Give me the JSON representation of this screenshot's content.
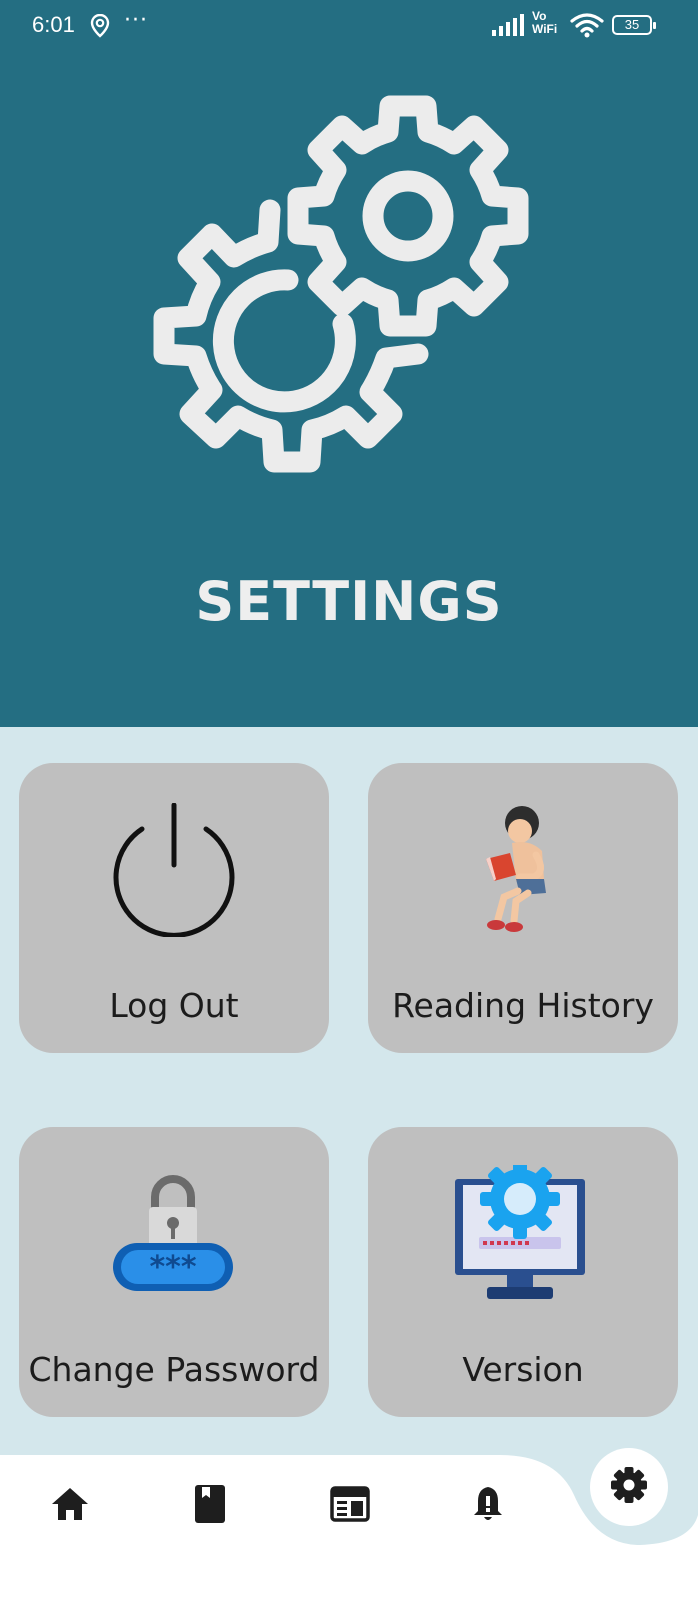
{
  "status_bar": {
    "time": "6:01",
    "dots": "···",
    "network": "Vo\nWiFi",
    "network_line1": "Vo",
    "network_line2": "WiFi",
    "battery": "35"
  },
  "header": {
    "title": "SETTINGS",
    "icon": "gears-icon"
  },
  "cards": [
    {
      "label": "Log Out",
      "icon": "power-icon"
    },
    {
      "label": "Reading History",
      "icon": "reading-person-icon"
    },
    {
      "label": "Change Password",
      "icon": "password-lock-icon"
    },
    {
      "label": "Version",
      "icon": "monitor-settings-icon"
    }
  ],
  "bottom_nav": {
    "items": [
      {
        "icon": "home-icon"
      },
      {
        "icon": "book-icon"
      },
      {
        "icon": "newspaper-icon"
      },
      {
        "icon": "bell-icon"
      },
      {
        "icon": "gear-icon",
        "active": true
      }
    ]
  },
  "colors": {
    "header_bg": "#246e82",
    "page_bg": "#d4e7ec",
    "card_bg": "#bfbfbf",
    "title_text": "#eeeeee"
  }
}
